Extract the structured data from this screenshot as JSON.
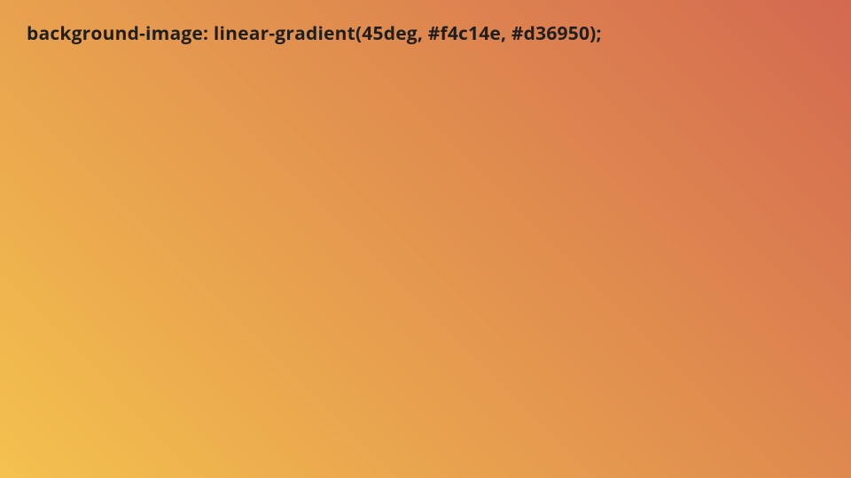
{
  "code_line": "background-image: linear-gradient(45deg, #f4c14e, #d36950);",
  "gradient": {
    "angle": "45deg",
    "color_start": "#f4c14e",
    "color_end": "#d36950"
  }
}
